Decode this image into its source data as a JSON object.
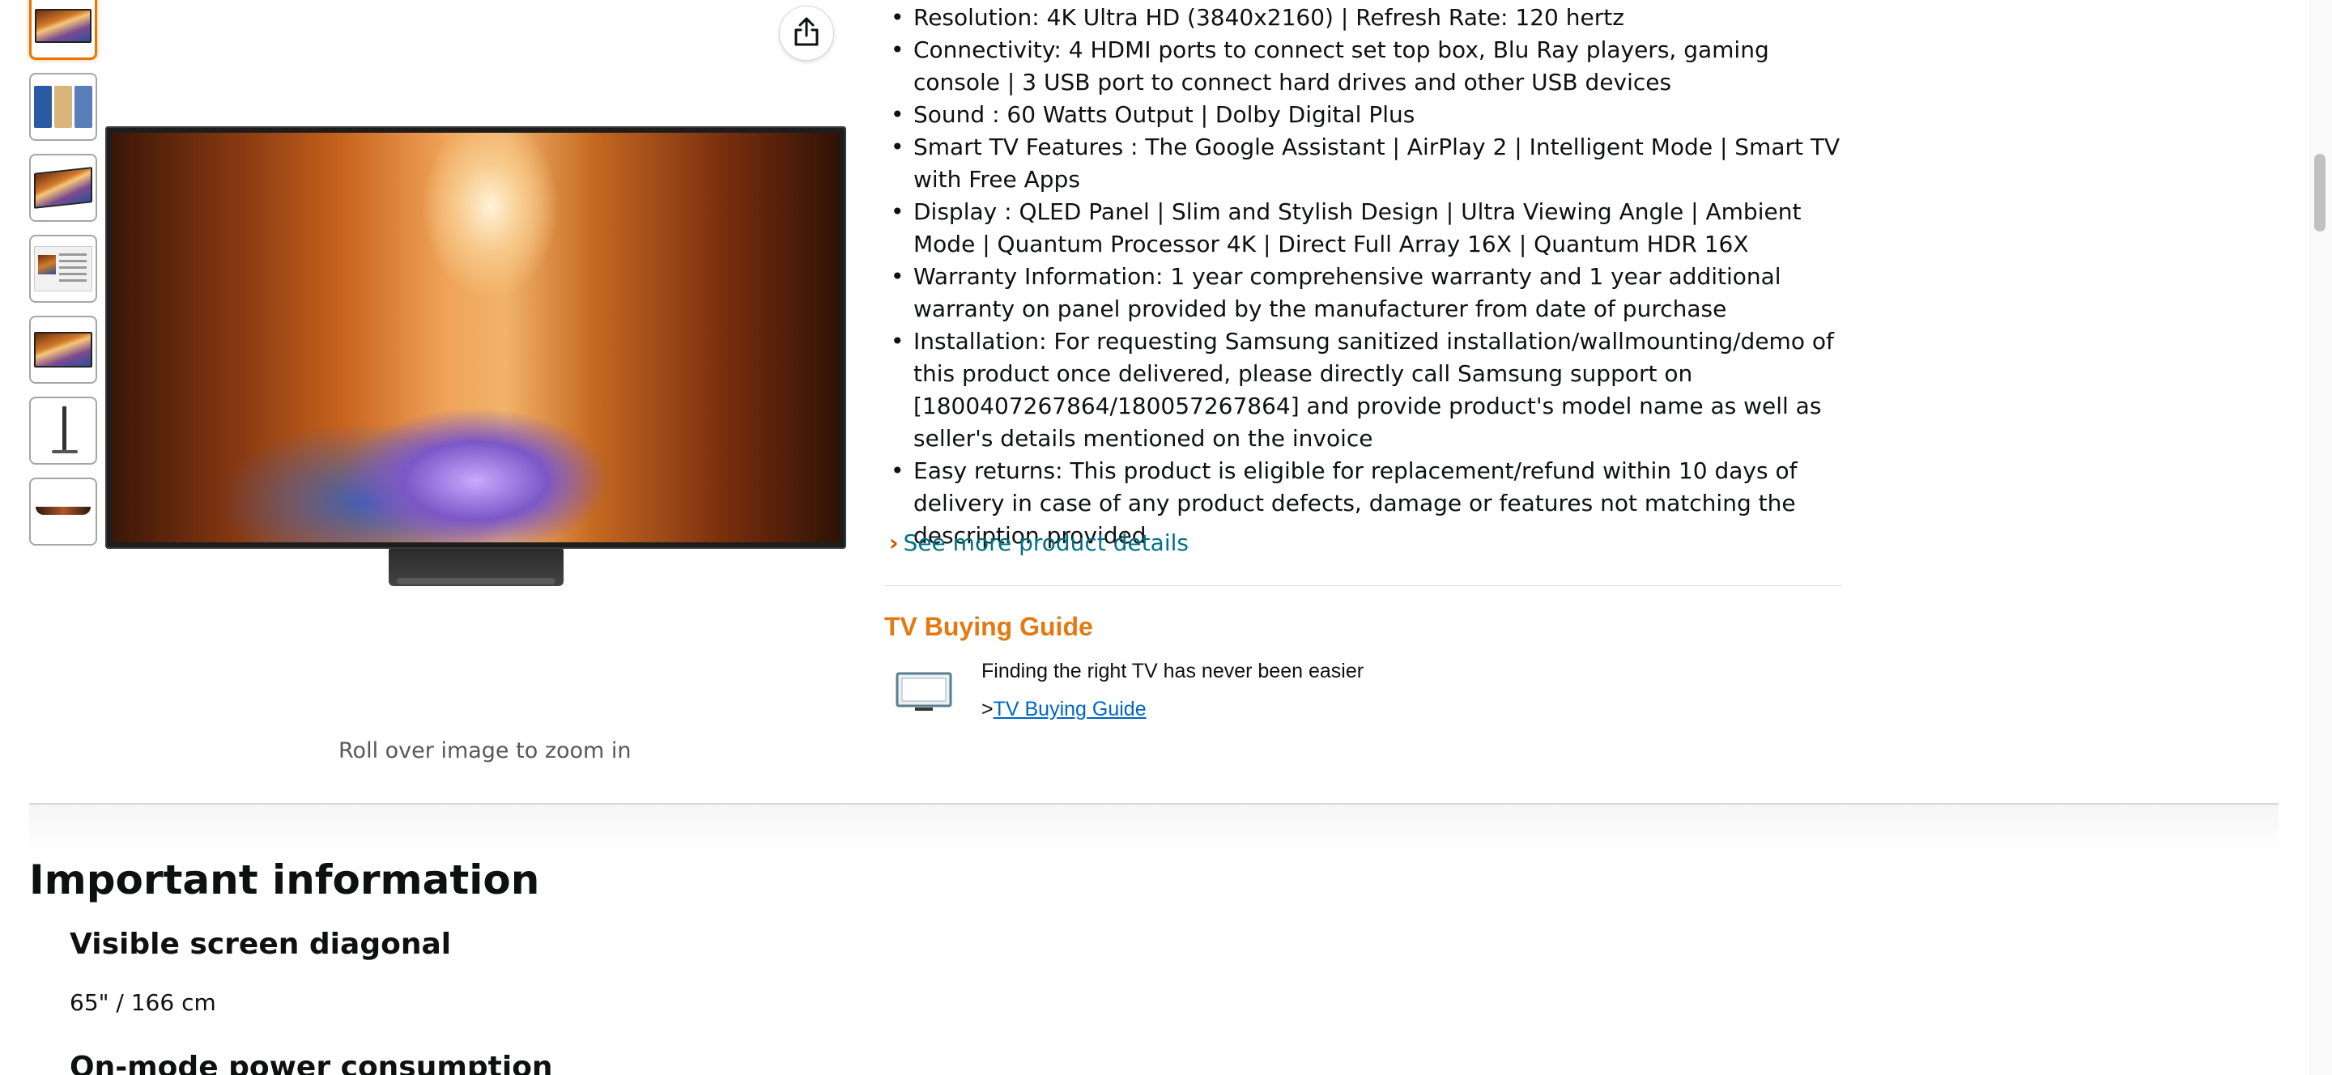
{
  "thumbnails": [
    {
      "name": "thumb-front-view",
      "selected": true
    },
    {
      "name": "thumb-collage",
      "selected": false
    },
    {
      "name": "thumb-angle-view",
      "selected": false
    },
    {
      "name": "thumb-spec-sheet",
      "selected": false
    },
    {
      "name": "thumb-front-view-2",
      "selected": false
    },
    {
      "name": "thumb-side-profile",
      "selected": false
    },
    {
      "name": "thumb-top-view",
      "selected": false
    }
  ],
  "gallery": {
    "zoom_hint": "Roll over image to zoom in",
    "share_icon": "share-icon"
  },
  "bullets": [
    "Resolution: 4K Ultra HD (3840x2160) | Refresh Rate: 120 hertz",
    "Connectivity: 4 HDMI ports to connect set top box, Blu Ray players, gaming console | 3 USB port to connect hard drives and other USB devices",
    "Sound : 60 Watts Output | Dolby Digital Plus",
    "Smart TV Features : The Google Assistant | AirPlay 2 | Intelligent Mode | Smart TV with Free Apps",
    "Display : QLED Panel | Slim and Stylish Design | Ultra Viewing Angle | Ambient Mode | Quantum Processor 4K | Direct Full Array 16X | Quantum HDR 16X",
    "Warranty Information: 1 year comprehensive warranty and 1 year additional warranty on panel provided by the manufacturer from date of purchase",
    "Installation: For requesting Samsung sanitized installation/wallmounting/demo of this product once delivered, please directly call Samsung support on [1800407267864/180057267864] and provide product's model name as well as seller's details mentioned on the invoice",
    "Easy returns: This product is eligible for replacement/refund within 10 days of delivery in case of any product defects, damage or features not matching the description provided"
  ],
  "see_more": {
    "chevron": "›",
    "label": "See more product details"
  },
  "tv_guide": {
    "title": "TV Buying Guide",
    "description": "Finding the right TV has never been easier",
    "link_prefix": ">",
    "link_label": "TV Buying Guide"
  },
  "important_info": {
    "heading": "Important information",
    "sections": [
      {
        "title": "Visible screen diagonal",
        "value": "65\" / 166 cm"
      },
      {
        "title": "On-mode power consumption"
      }
    ]
  },
  "colors": {
    "link": "#007185",
    "guide_title": "#e47911",
    "selected_thumb_border": "#e77600",
    "text": "#0f1111"
  }
}
